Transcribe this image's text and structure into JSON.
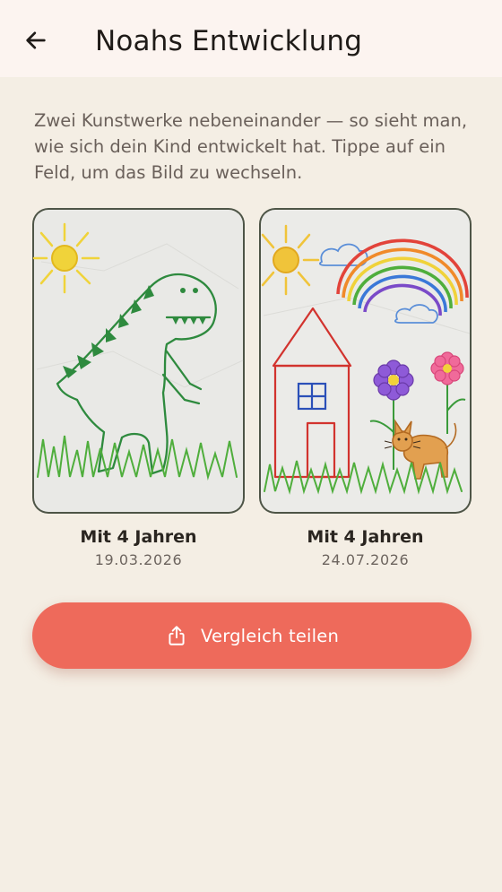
{
  "header": {
    "back_icon": "arrow-left-icon",
    "title": "Noahs Entwicklung"
  },
  "intro_text": "Zwei Kunstwerke nebeneinander — so sieht man, wie sich dein Kind entwickelt hat. Tippe auf ein Feld, um das Bild zu wechseln.",
  "artworks": [
    {
      "age_label": "Mit 4 Jahren",
      "date": "19.03.2026",
      "subject": "dinosaur-drawing"
    },
    {
      "age_label": "Mit 4 Jahren",
      "date": "24.07.2026",
      "subject": "house-rainbow-cat-drawing"
    }
  ],
  "share_button": {
    "label": "Vergleich teilen",
    "icon": "share-icon"
  },
  "colors": {
    "background": "#f4eee4",
    "app_bar": "#fcf4f0",
    "accent": "#ee6a5b"
  }
}
